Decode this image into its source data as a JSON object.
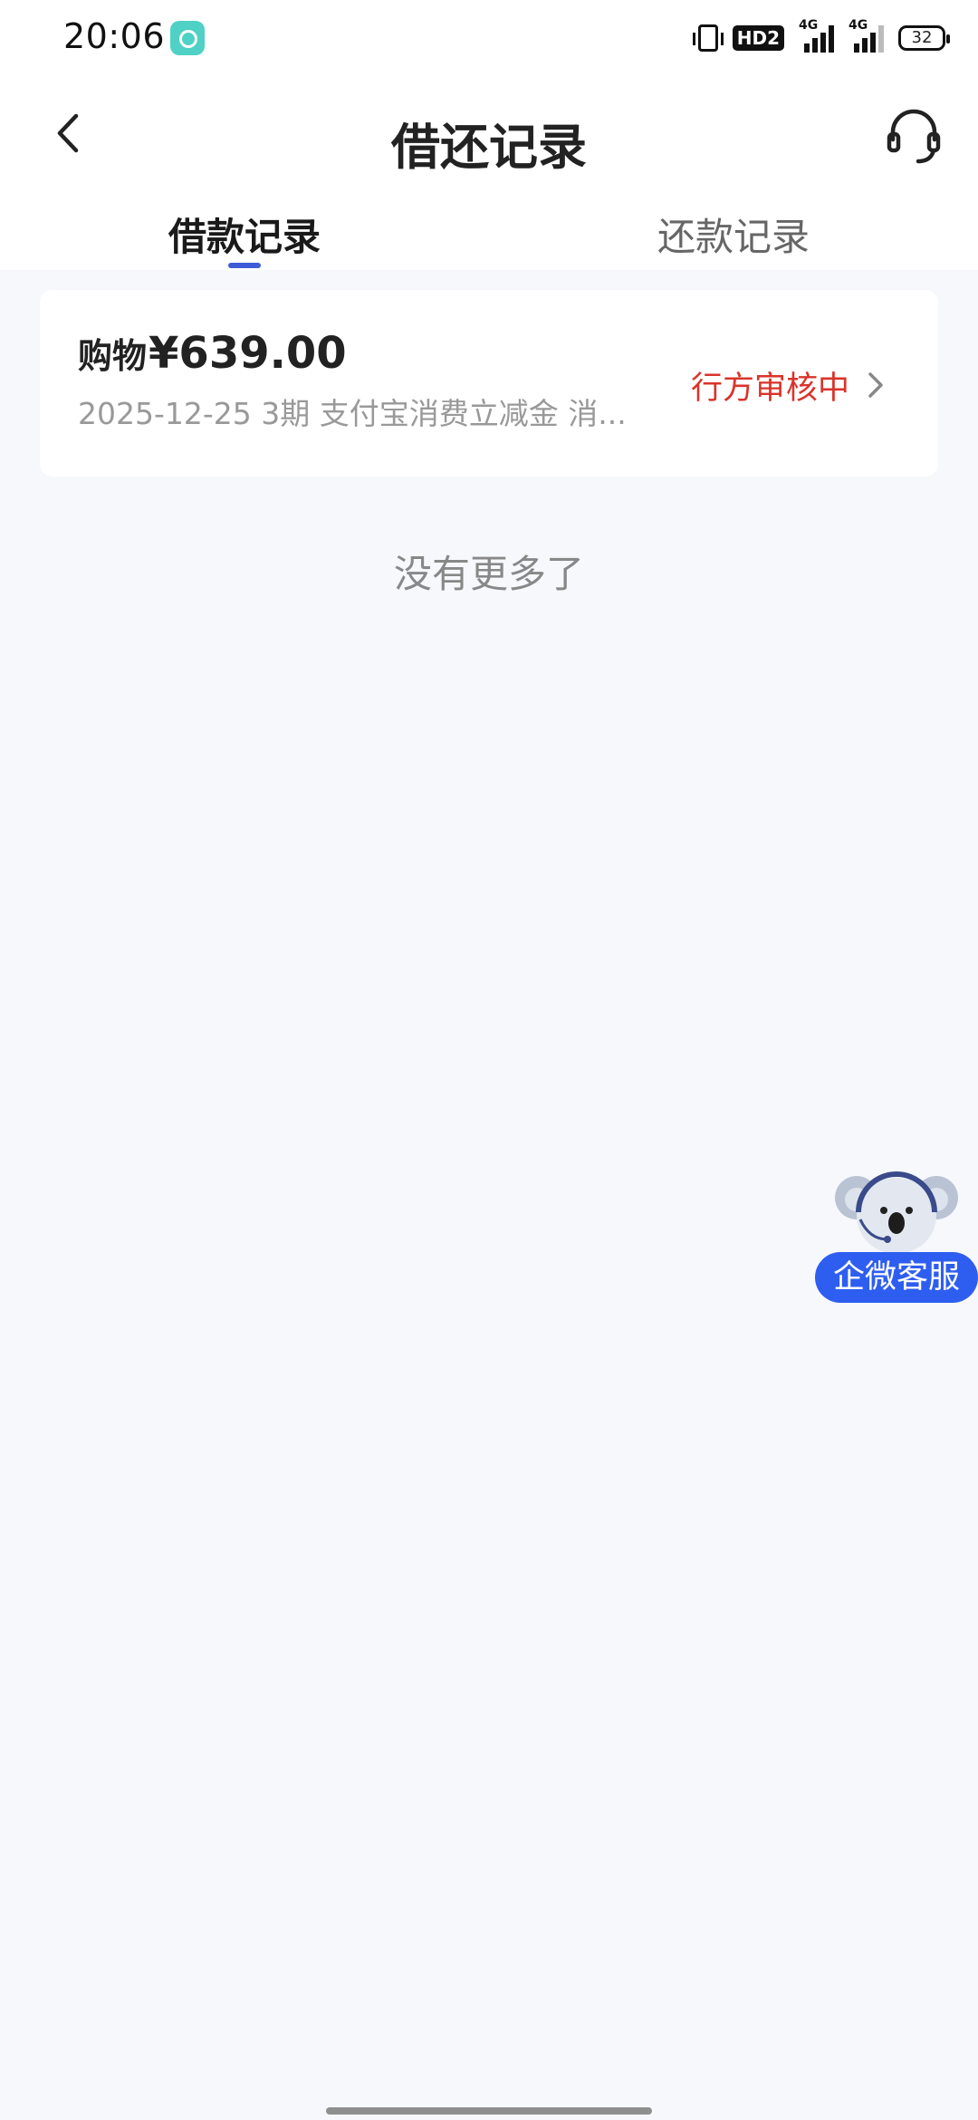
{
  "status_bar": {
    "time": "20:06",
    "hd_label": "HD2",
    "signal1_label": "4G",
    "signal2_label": "4G",
    "battery_level": "32"
  },
  "nav": {
    "title": "借还记录",
    "back_icon": "chevron-left-icon",
    "service_icon": "headset-icon"
  },
  "tabs": [
    {
      "label": "借款记录",
      "active": true
    },
    {
      "label": "还款记录",
      "active": false
    }
  ],
  "records": [
    {
      "type": "购物",
      "amount": "¥639.00",
      "subtitle": "2025-12-25 3期  支付宝消费立减金 消...",
      "status": "行方审核中"
    }
  ],
  "list_end_text": "没有更多了",
  "floating_service": {
    "label": "企微客服",
    "icon": "koala-mascot-icon"
  },
  "colors": {
    "accent": "#3f5bd6",
    "status_red": "#d9342b",
    "service_blue": "#2e5ef0",
    "background": "#f7f8fc"
  }
}
